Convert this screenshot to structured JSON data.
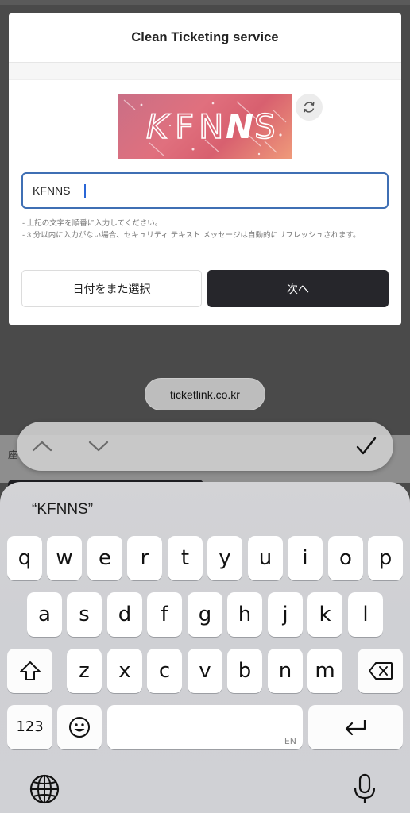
{
  "modal": {
    "title": "Clean Ticketing service",
    "captcha_text": "KFNNS",
    "input_value": "KFNNS",
    "notes": [
      "- 上記の文字を順番に入力してください。",
      "- 3 分以内に入力がない場合、セキュリティ テキスト メッセージは自動的にリフレッシュされます。"
    ],
    "btn_reselect": "日付をまた選択",
    "btn_next": "次へ"
  },
  "backdrop": {
    "partial_text": "座"
  },
  "url": "ticketlink.co.kr",
  "keyboard": {
    "suggestion": "“KFNNS”",
    "row1": [
      "q",
      "w",
      "e",
      "r",
      "t",
      "y",
      "u",
      "i",
      "o",
      "p"
    ],
    "row2": [
      "a",
      "s",
      "d",
      "f",
      "g",
      "h",
      "j",
      "k",
      "l"
    ],
    "row3": [
      "z",
      "x",
      "c",
      "v",
      "b",
      "n",
      "m"
    ],
    "numbers_label": "123",
    "space_lang": "EN"
  }
}
